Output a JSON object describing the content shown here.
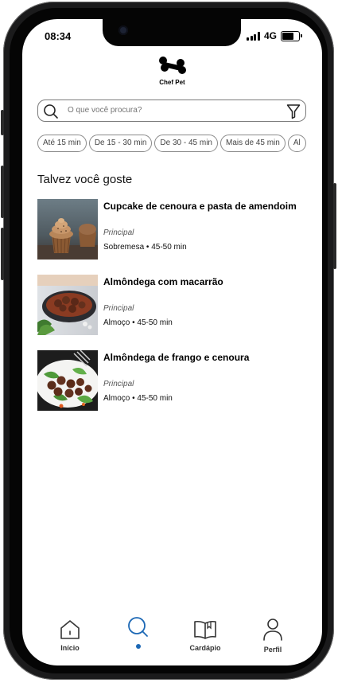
{
  "status_bar": {
    "time": "08:34",
    "network": "4G"
  },
  "app": {
    "name": "Chef Pet",
    "logo_icon": "bone-icon"
  },
  "search": {
    "placeholder": "O que você procura?",
    "icon": "search-icon",
    "filter_icon": "filter-icon"
  },
  "filters": [
    {
      "label": "Até 15 min"
    },
    {
      "label": "De 15 - 30 min"
    },
    {
      "label": "De 30 - 45 min"
    },
    {
      "label": "Mais de 45 min"
    },
    {
      "label": "Al"
    }
  ],
  "section": {
    "title": "Talvez você goste"
  },
  "recipes": [
    {
      "title": "Cupcake de cenoura e pasta de amendoim",
      "category": "Principal",
      "meta": "Sobremesa • 45-50 min",
      "image": "cupcake-photo"
    },
    {
      "title": "Almôndega com macarrão",
      "category": "Principal",
      "meta": "Almoço • 45-50 min",
      "image": "meatballs-pasta-photo"
    },
    {
      "title": "Almôndega de frango e cenoura",
      "category": "Principal",
      "meta": "Almoço • 45-50 min",
      "image": "chicken-meatballs-photo"
    }
  ],
  "nav": {
    "items": [
      {
        "label": "Início",
        "icon": "home-icon"
      },
      {
        "label": "",
        "icon": "search-icon",
        "active": true
      },
      {
        "label": "Cardápio",
        "icon": "book-icon"
      },
      {
        "label": "Perfil",
        "icon": "user-icon"
      }
    ],
    "active_color": "#1c68b5"
  }
}
